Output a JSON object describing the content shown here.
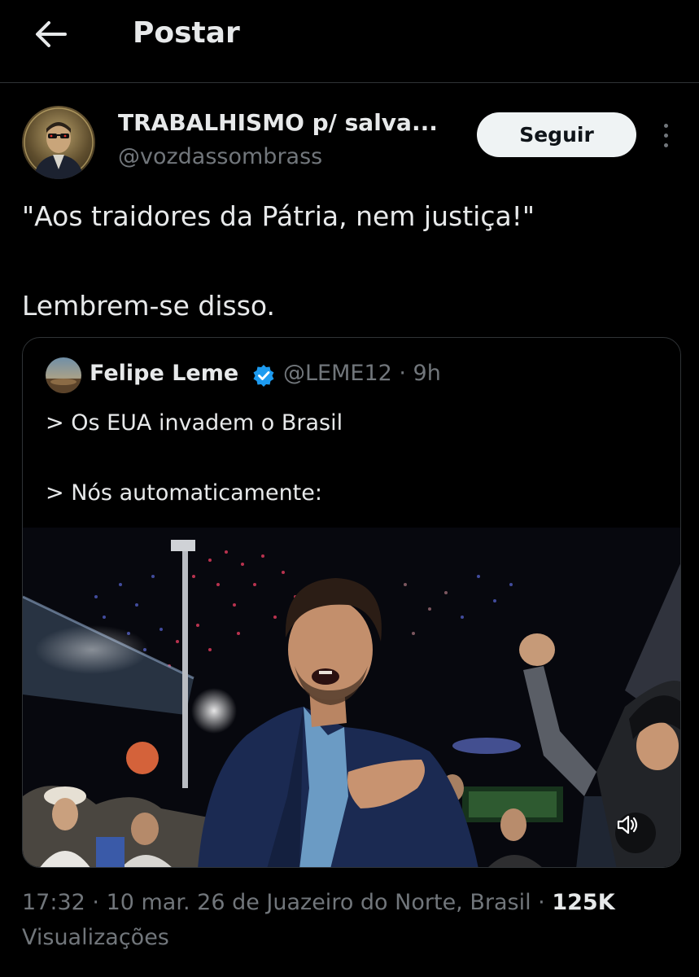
{
  "header": {
    "back_icon": "arrow-left-icon",
    "title": "Postar"
  },
  "post": {
    "display_name": "TRABALHISMO p/ salva...",
    "handle": "@vozdassombrass",
    "follow_label": "Seguir",
    "more_icon": "more-vertical-icon",
    "text_line_1": "\"Aos traidores da Pátria, nem justiça!\"",
    "text_line_2": "Lembrem-se disso."
  },
  "quote": {
    "name": "Felipe Leme",
    "verified_icon": "verified-badge-icon",
    "meta": "@LEME12 · 9h",
    "line_1": "> Os EUA invadem o Brasil",
    "line_2": "> Nós automaticamente:",
    "media_type": "video",
    "sound_icon": "volume-icon"
  },
  "footer": {
    "time": "17:32",
    "date_location": "10 mar. 26 de Juazeiro do Norte, Brasil",
    "sep": " · ",
    "views_count": "125K",
    "views_label": "Visualizações"
  },
  "colors": {
    "background": "#000000",
    "text": "#e7e9ea",
    "secondary": "#71767b",
    "border": "#2f3336",
    "verified": "#1d9bf0",
    "follow_bg": "#eff3f4"
  }
}
